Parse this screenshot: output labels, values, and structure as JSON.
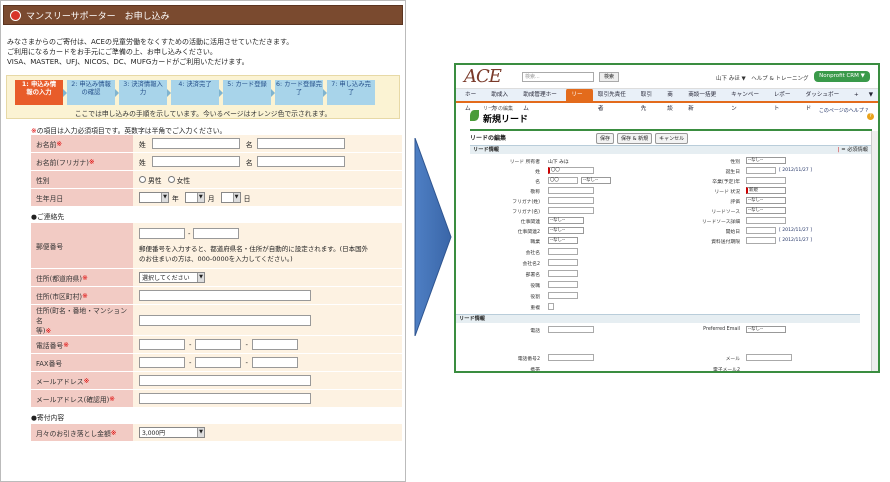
{
  "left": {
    "title": "マンスリーサポーター　お申し込み",
    "intro": [
      "みなさまからのご寄付は、ACEの児童労働をなくすための活動に活用させていただきます。",
      "ご利用になるカードをお手元にご準備の上、お申し込みください。",
      "VISA、MASTER、UFJ、NICOS、DC、MUFGカードがご利用いただけます。"
    ],
    "steps": [
      {
        "line1": "1: 申込み情",
        "line2": "報の入力"
      },
      {
        "line1": "2: 申込み情報",
        "line2": "の確認"
      },
      {
        "line1": "3: 決済情報入",
        "line2": "力"
      },
      {
        "line1": "4: 決済完了",
        "line2": ""
      },
      {
        "line1": "5: カード登録",
        "line2": ""
      },
      {
        "line1": "6: カード登録完",
        "line2": "了"
      },
      {
        "line1": "7: 申し込み完",
        "line2": "了"
      }
    ],
    "step_note": "ここでは申し込みの手順を示しています。今いるページはオレンジ色で示されます。",
    "req_mark": "※",
    "req_note": "の項目は入力必須項目です。英数字は半角でご入力ください。",
    "name_row": {
      "label": "お名前",
      "m": "※",
      "sei": "姓",
      "mei": "名"
    },
    "kana_row": {
      "label": "お名前(フリガナ)",
      "m": "※",
      "sei": "姓",
      "mei": "名"
    },
    "gender_row": {
      "label": "性別",
      "male": "男性",
      "female": "女性"
    },
    "birth_row": {
      "label": "生年月日",
      "year": "年",
      "month": "月",
      "day": "日"
    },
    "contact_heading": "●ご連絡先",
    "postal_row": {
      "label": "郵便番号",
      "dash": "-",
      "note1": "郵便番号を入力すると、都道府県名・住所が自動的に設定されます。(日本国外",
      "note2": "のお住まいの方は、000-0000を入力してください。)"
    },
    "pref_row": {
      "label": "住所(都道府県)",
      "m": "※",
      "select": "選択してください"
    },
    "city_row": {
      "label": "住所(市区町村)",
      "m": "※"
    },
    "street_row": {
      "label1": "住所(町名・番地・マンション名",
      "label2": "等)",
      "m": "※"
    },
    "phone_row": {
      "label": "電話番号",
      "m": "※",
      "dash": "-"
    },
    "fax_row": {
      "label": "FAX番号",
      "dash": "-"
    },
    "email_row": {
      "label": "メールアドレス",
      "m": "※"
    },
    "email2_row": {
      "label": "メールアドレス(確認用)",
      "m": "※"
    },
    "donation_heading": "●寄付内容",
    "amount_row": {
      "label": "月々のお引き落とし金額",
      "m": "※",
      "select": "3,000円"
    }
  },
  "right": {
    "logo": "ACE",
    "search_placeholder": "検索...",
    "search_btn": "検索",
    "user_links": "山下 みほ ▼　ヘルプ & トレーニング",
    "app_menu": "Nonprofit CRM ▼",
    "tabs": [
      "ホーム",
      "助成入力",
      "助成管理ホーム",
      "リード",
      "取引先責任者",
      "取引先",
      "商談",
      "商談一括更新",
      "キャンペーン",
      "レポート",
      "ダッシュボード",
      "+",
      "▼"
    ],
    "active_tab": "リード",
    "crumb": "リードの編集",
    "page_title": "新規リード",
    "help_link": "このページのヘルプ ?",
    "edit_title": "リードの編集",
    "buttons": [
      "保存",
      "保存 & 新規",
      "キャンセル"
    ],
    "sec1": "リード情報",
    "req_legend": "= 必須情報",
    "left_fields": [
      {
        "label": "リード 所有者",
        "value": "山下 みほ"
      },
      {
        "label": "姓",
        "value": "〇〇"
      },
      {
        "label": "名",
        "value": "〇〇"
      },
      {
        "label": "敬称",
        "value": ""
      },
      {
        "label": "フリガナ(姓)",
        "value": ""
      },
      {
        "label": "フリガナ(名)",
        "value": ""
      },
      {
        "label": "仕事関連",
        "value": "--なし--"
      },
      {
        "label": "仕事関連2",
        "value": "--なし--"
      },
      {
        "label": "職業",
        "value": "--なし--"
      },
      {
        "label": "会社名",
        "value": ""
      },
      {
        "label": "会社名2",
        "value": ""
      },
      {
        "label": "部署名",
        "value": ""
      },
      {
        "label": "役職",
        "value": ""
      },
      {
        "label": "役割",
        "value": ""
      },
      {
        "label": "重複",
        "value": ""
      }
    ],
    "name_select": "--なし--",
    "right_fields": [
      {
        "label": "性別",
        "value": "--なし--"
      },
      {
        "label": "誕生日",
        "value": "",
        "link": "[ 2012/11/27 ]"
      },
      {
        "label": "卒業(予定)年",
        "value": ""
      },
      {
        "label": "リード 状況",
        "value": "新規"
      },
      {
        "label": "評価",
        "value": "--なし--"
      },
      {
        "label": "リードソース",
        "value": "--なし--"
      },
      {
        "label": "リードソース詳細",
        "value": ""
      },
      {
        "label": "開始日",
        "value": "",
        "link": "[ 2012/11/27 ]"
      },
      {
        "label": "資料送付期限",
        "value": "",
        "link": "[ 2012/11/27 ]"
      }
    ],
    "sec2": "リード情報",
    "bottom_left": [
      {
        "label": "電話"
      },
      {
        "label": "電話番号2"
      },
      {
        "label": "携帯"
      }
    ],
    "bottom_right": [
      {
        "label": "Preferred Email",
        "value": "--なし--"
      },
      {
        "label": "メール",
        "value": ""
      },
      {
        "label": "電子メール2",
        "value": ""
      }
    ]
  }
}
